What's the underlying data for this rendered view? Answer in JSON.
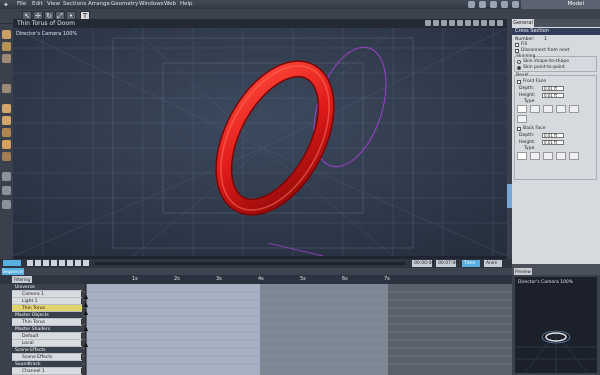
{
  "menu": {
    "items": [
      "File",
      "Edit",
      "View",
      "Sections",
      "Arrange",
      "Geometry",
      "Windows",
      "Web",
      "Help"
    ],
    "mode_button": "Model"
  },
  "viewport": {
    "title": "Thin Torus of Doom",
    "camera_label": "Director's Camera 100%"
  },
  "transport": {
    "frame_start": "00:00:00",
    "frame_end": "00:07:00",
    "time_label": "Time",
    "anim_label": "Anim"
  },
  "panel": {
    "tab": "General",
    "header": "Cross Section",
    "number_label": "Number:",
    "number_value": "1",
    "fill_label": "Fill",
    "disconnect_label": "Disconnect from next",
    "skinning_title": "Skinning",
    "skin_shape_label": "Skin shape-to-shape",
    "skin_point_label": "Skin point-to-point",
    "bevel_title": "Bevel",
    "front_face_label": "Front Face",
    "front_depth_label": "Depth:",
    "front_depth_value": "0.01 ft",
    "front_height_label": "Height:",
    "front_height_value": "0.01 ft",
    "front_type_label": "Type",
    "back_face_label": "Back Face",
    "back_depth_label": "Depth:",
    "back_depth_value": "0.01 ft",
    "back_height_label": "Height:",
    "back_height_value": "0.01 ft",
    "back_type_label": "Type"
  },
  "timeline": {
    "sequencer_label": "Sequencer",
    "filtering_label": "Filtering",
    "ms_label": "Sh",
    "snap_label": "Snap",
    "ruler_ticks": [
      "1s",
      "2s",
      "3s",
      "4s",
      "5s",
      "6s",
      "7s"
    ],
    "tree": [
      {
        "label": "Universe",
        "type": "section"
      },
      {
        "label": "Camera 1",
        "type": "item"
      },
      {
        "label": "Light 1",
        "type": "item"
      },
      {
        "label": "Thin Torus",
        "type": "selected"
      },
      {
        "label": "Master Objects",
        "type": "section"
      },
      {
        "label": "Thin Torus",
        "type": "item"
      },
      {
        "label": "Master Shaders",
        "type": "section"
      },
      {
        "label": "Default",
        "type": "item"
      },
      {
        "label": "Local",
        "type": "item"
      },
      {
        "label": "Scene Effects",
        "type": "section"
      },
      {
        "label": "Scene Effects",
        "type": "item"
      },
      {
        "label": "Soundtrack",
        "type": "section"
      },
      {
        "label": "Channel 1",
        "type": "item"
      }
    ]
  },
  "preview": {
    "tab": "Preview",
    "camera_label": "Director's Camera 100%"
  },
  "colors": {
    "torus": "#e01a1a",
    "selection": "#e2d36a",
    "gizmo": "#a23ecf",
    "panel_header": "#2f3d5a"
  }
}
